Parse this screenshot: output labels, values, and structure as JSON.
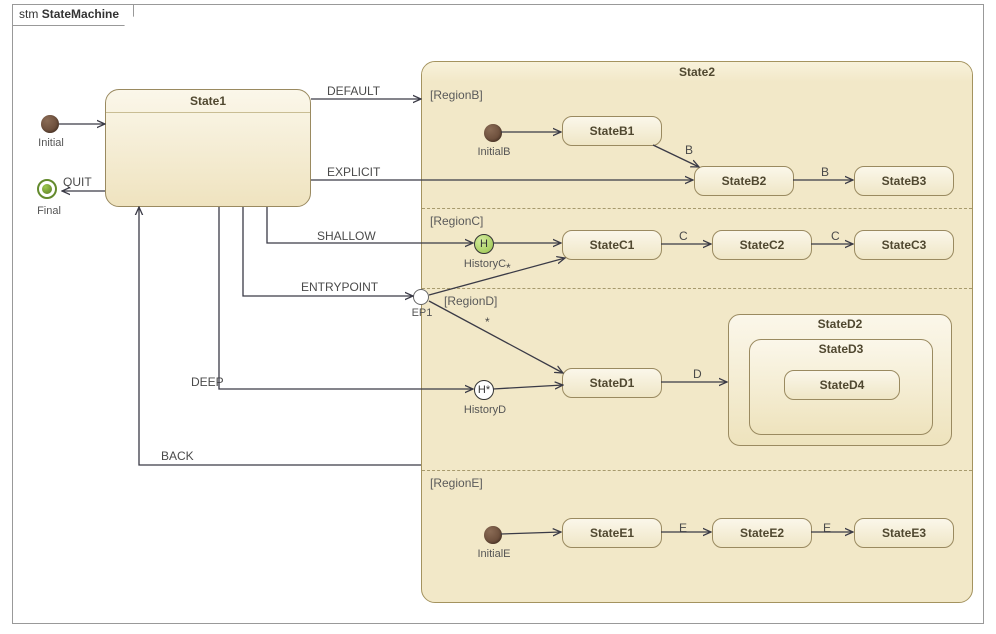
{
  "frame": {
    "prefix": "stm",
    "title": "StateMachine"
  },
  "pseudo": {
    "initial_label": "Initial",
    "final_label": "Final",
    "initialB_label": "InitialB",
    "initialE_label": "InitialE",
    "historyC_label": "HistoryC",
    "historyD_label": "HistoryD",
    "ep1_label": "EP1",
    "history_shallow_glyph": "H",
    "history_deep_glyph": "H*",
    "star": "*"
  },
  "states": {
    "s1": "State1",
    "s2": "State2",
    "b1": "StateB1",
    "b2": "StateB2",
    "b3": "StateB3",
    "c1": "StateC1",
    "c2": "StateC2",
    "c3": "StateC3",
    "d1": "StateD1",
    "d2": "StateD2",
    "d3": "StateD3",
    "d4": "StateD4",
    "e1": "StateE1",
    "e2": "StateE2",
    "e3": "StateE3"
  },
  "regions": {
    "b": "[RegionB]",
    "c": "[RegionC]",
    "d": "[RegionD]",
    "e": "[RegionE]"
  },
  "transitions": {
    "default": "DEFAULT",
    "explicit": "EXPLICIT",
    "shallow": "SHALLOW",
    "entrypoint": "ENTRYPOINT",
    "deep": "DEEP",
    "back": "BACK",
    "quit": "QUIT",
    "b": "B",
    "c": "C",
    "d": "D",
    "e": "E"
  }
}
